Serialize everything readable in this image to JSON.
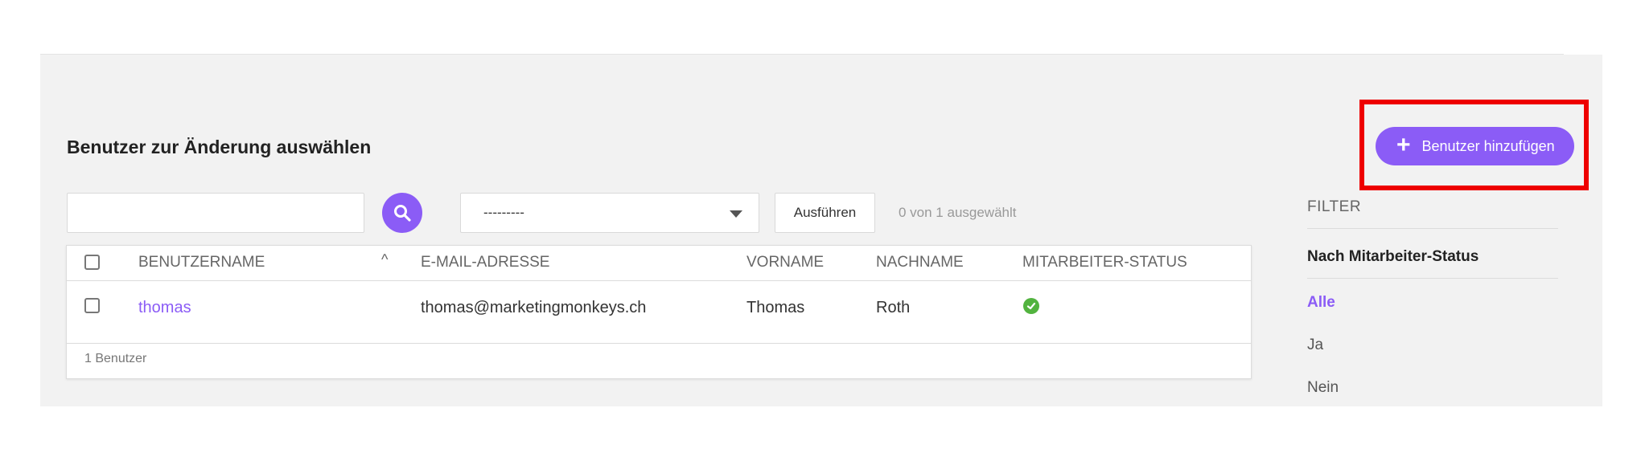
{
  "header": {
    "title": "Benutzer zur Änderung auswählen",
    "add_button_label": "Benutzer hinzufügen"
  },
  "toolbar": {
    "search_value": "",
    "action_selected": "---------",
    "run_label": "Ausführen",
    "selection_count": "0 von 1 ausgewählt"
  },
  "table": {
    "columns": [
      "BENUTZERNAME",
      "E-MAIL-ADRESSE",
      "VORNAME",
      "NACHNAME",
      "MITARBEITER-STATUS"
    ],
    "rows": [
      {
        "username": "thomas",
        "email": "thomas@marketingmonkeys.ch",
        "first_name": "Thomas",
        "last_name": "Roth",
        "staff_status_icon": "check-circle-icon"
      }
    ],
    "footer": "1 Benutzer"
  },
  "filter": {
    "title": "FILTER",
    "section": "Nach Mitarbeiter-Status",
    "options": [
      "Alle",
      "Ja",
      "Nein"
    ],
    "active": "Alle"
  },
  "colors": {
    "accent": "#8b5cf6",
    "panel_bg": "#f2f2f2",
    "status_ok": "#52b33f",
    "highlight": "#ee0000"
  }
}
